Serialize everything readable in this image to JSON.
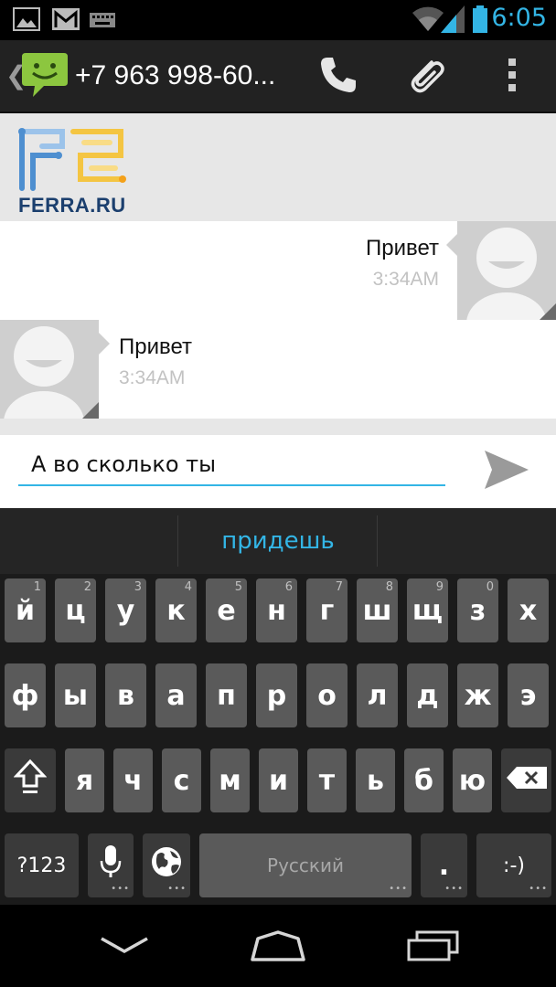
{
  "status_bar": {
    "time": "6:05",
    "icons": [
      "picture-icon",
      "gmail-icon",
      "keyboard-icon",
      "wifi-icon",
      "signal-icon",
      "battery-icon"
    ],
    "accent": "#33b5e5"
  },
  "action_bar": {
    "back_glyph": "❮",
    "title": "+7 963 998-60...",
    "app_icon": "messaging-app-icon",
    "actions": [
      "phone-icon",
      "attach-icon",
      "overflow-menu-icon"
    ]
  },
  "conversation": {
    "logo_text": "FERRA.RU",
    "messages": [
      {
        "direction": "outgoing",
        "text": "Привет",
        "time": "3:34AM"
      },
      {
        "direction": "incoming",
        "text": "Привет",
        "time": "3:34AM"
      }
    ]
  },
  "composer": {
    "value": "А во сколько ты",
    "send_icon": "send-icon"
  },
  "keyboard": {
    "suggestion": "придешь",
    "row1": [
      {
        "label": "й",
        "hint": "1"
      },
      {
        "label": "ц",
        "hint": "2"
      },
      {
        "label": "у",
        "hint": "3"
      },
      {
        "label": "к",
        "hint": "4"
      },
      {
        "label": "е",
        "hint": "5"
      },
      {
        "label": "н",
        "hint": "6"
      },
      {
        "label": "г",
        "hint": "7"
      },
      {
        "label": "ш",
        "hint": "8"
      },
      {
        "label": "щ",
        "hint": "9"
      },
      {
        "label": "з",
        "hint": "0"
      },
      {
        "label": "х",
        "hint": ""
      }
    ],
    "row2": [
      "ф",
      "ы",
      "в",
      "а",
      "п",
      "р",
      "о",
      "л",
      "д",
      "ж",
      "э"
    ],
    "row3": [
      "я",
      "ч",
      "с",
      "м",
      "и",
      "т",
      "ь",
      "б",
      "ю"
    ],
    "symbols_label": "?123",
    "space_label": "Русский",
    "period_label": ".",
    "smiley_label": ":-)"
  },
  "nav_bar": {
    "buttons": [
      "back-icon",
      "home-icon",
      "recents-icon"
    ]
  },
  "colors": {
    "accent": "#33b5e5",
    "key": "#5a5a5a",
    "key_dark": "#3a3a3a",
    "app_green": "#8cc63f"
  }
}
